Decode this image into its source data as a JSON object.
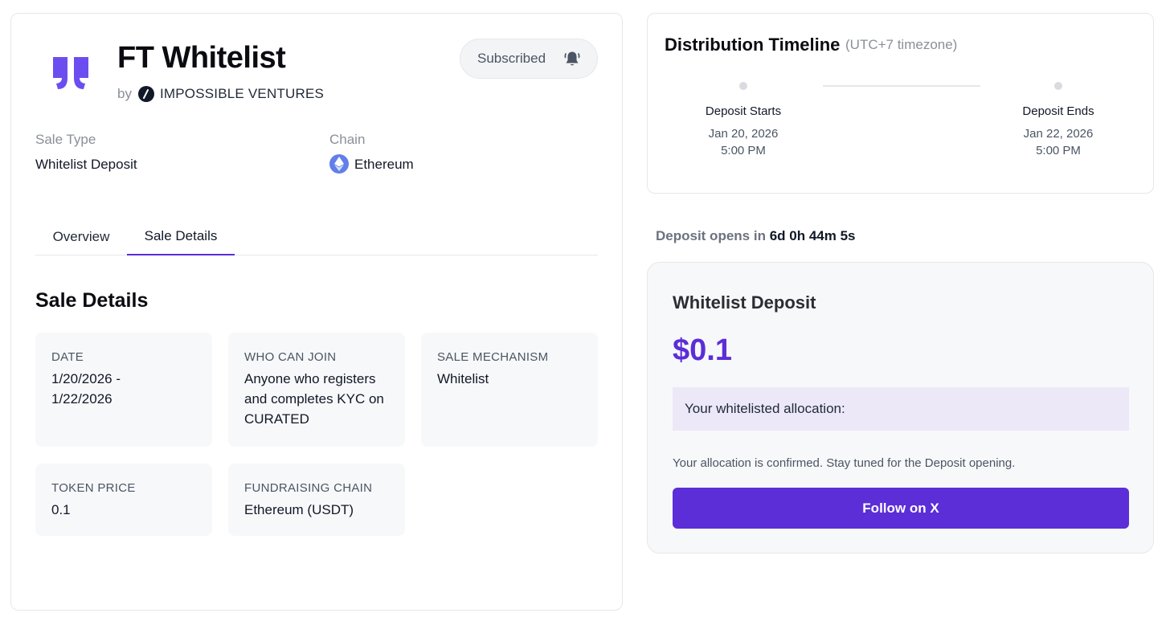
{
  "project": {
    "title": "FT Whitelist",
    "by_label": "by",
    "venture_name": "IMPOSSIBLE VENTURES",
    "subscribe_label": "Subscribed"
  },
  "meta": {
    "sale_type_label": "Sale Type",
    "sale_type_value": "Whitelist Deposit",
    "chain_label": "Chain",
    "chain_value": "Ethereum"
  },
  "tabs": [
    {
      "label": "Overview",
      "active": false
    },
    {
      "label": "Sale Details",
      "active": true
    }
  ],
  "sale_details": {
    "title": "Sale Details",
    "items": [
      {
        "label": "DATE",
        "value": "1/20/2026 - 1/22/2026"
      },
      {
        "label": "WHO CAN JOIN",
        "value": "Anyone who registers and completes KYC on CURATED"
      },
      {
        "label": "SALE MECHANISM",
        "value": "Whitelist"
      },
      {
        "label": "TOKEN PRICE",
        "value": "0.1"
      },
      {
        "label": "FUNDRAISING CHAIN",
        "value": "Ethereum (USDT)"
      }
    ]
  },
  "timeline": {
    "title": "Distribution Timeline",
    "timezone": "(UTC+7 timezone)",
    "steps": [
      {
        "name": "Deposit Starts",
        "date": "Jan 20, 2026",
        "time": "5:00 PM"
      },
      {
        "name": "Deposit Ends",
        "date": "Jan 22, 2026",
        "time": "5:00 PM"
      }
    ]
  },
  "countdown": {
    "label": "Deposit opens in",
    "value": "6d 0h 44m 5s"
  },
  "deposit": {
    "title": "Whitelist Deposit",
    "price": "$0.1",
    "allocation_label": "Your whitelisted allocation:",
    "note": "Your allocation is confirmed. Stay tuned for the Deposit opening.",
    "button_label": "Follow on X"
  },
  "colors": {
    "accent": "#5b2ed8",
    "logo": "#6c4ef0",
    "ethereum": "#627eea",
    "allocation_bg": "#ece8f8"
  },
  "icons": {
    "logo": "project-logo-icon",
    "venture": "impossible-ventures-icon",
    "bell": "bell-icon",
    "chain": "ethereum-icon"
  }
}
